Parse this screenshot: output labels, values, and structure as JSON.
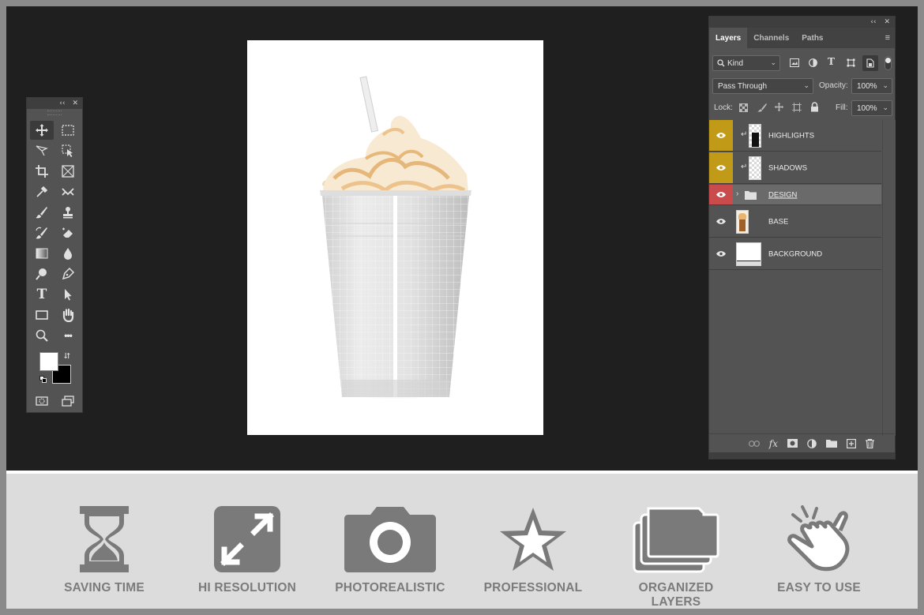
{
  "toolbox": {
    "collapse_glyph": "‹‹",
    "close_glyph": "✕",
    "tools": [
      "move-tool",
      "marquee-tool",
      "lasso-tool",
      "object-select-tool",
      "crop-tool",
      "frame-tool",
      "eyedropper-tool",
      "healing-tool",
      "brush-tool",
      "stamp-tool",
      "history-brush-tool",
      "eraser-tool",
      "gradient-tool",
      "blur-tool",
      "dodge-tool",
      "pen-tool",
      "type-tool",
      "path-select-tool",
      "rectangle-tool",
      "hand-tool",
      "zoom-tool",
      "more-tools",
      "quick-mask",
      "screen-mode"
    ],
    "type_glyph": "T",
    "more_glyph": "•••",
    "foreground_color": "#ffffff",
    "background_color": "#000000"
  },
  "layers_panel": {
    "collapse_glyph": "‹‹",
    "close_glyph": "✕",
    "menu_glyph": "≡",
    "tabs": [
      {
        "label": "Layers"
      },
      {
        "label": "Channels"
      },
      {
        "label": "Paths"
      }
    ],
    "filter": {
      "label": "Kind"
    },
    "blend_mode": "Pass Through",
    "opacity_label": "Opacity:",
    "opacity_value": "100%",
    "lock_label": "Lock:",
    "fill_label": "Fill:",
    "fill_value": "100%",
    "layers": [
      {
        "name": "HIGHLIGHTS",
        "color_label": "#c19a18"
      },
      {
        "name": "SHADOWS",
        "color_label": "#c19a18"
      },
      {
        "name": "DESIGN",
        "color_label": "#c94b4b"
      },
      {
        "name": "BASE",
        "color_label": ""
      },
      {
        "name": "BACKGROUND",
        "color_label": ""
      }
    ],
    "footer_fx": "fx"
  },
  "features": [
    {
      "caption": "SAVING TIME",
      "icon": "hourglass-icon"
    },
    {
      "caption": "HI RESOLUTION",
      "icon": "expand-icon"
    },
    {
      "caption": "PHOTOREALISTIC",
      "icon": "camera-icon"
    },
    {
      "caption": "PROFESSIONAL",
      "icon": "star-icon"
    },
    {
      "caption": "ORGANIZED LAYERS",
      "icon": "folders-icon"
    },
    {
      "caption": "EASY TO USE",
      "icon": "tap-hand-icon"
    }
  ]
}
